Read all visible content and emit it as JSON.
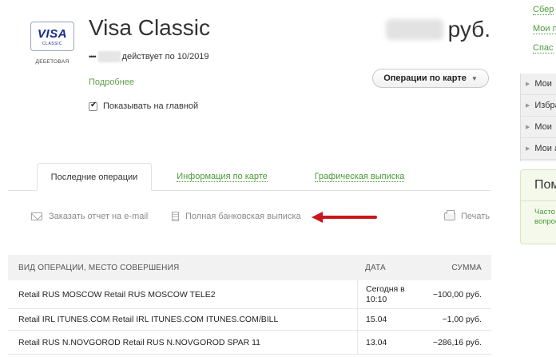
{
  "card": {
    "brand": "VISA",
    "brand_sub": "CLASSIC",
    "kind": "ДЕБЕТОВАЯ",
    "title": "Visa Classic",
    "masked_number": "••••",
    "valid_text": "действует по 10/2019",
    "currency": "руб.",
    "more_link": "Подробнее",
    "show_on_main_label": "Показывать на главной",
    "ops_button": "Операции по карте"
  },
  "tabs": [
    {
      "label": "Последние операции",
      "active": true
    },
    {
      "label": "Информация по карте",
      "active": false
    },
    {
      "label": "Графическая выписка",
      "active": false
    }
  ],
  "actions": {
    "email_report": "Заказать отчет на e-mail",
    "full_statement": "Полная банковская выписка",
    "print": "Печать"
  },
  "table": {
    "headers": [
      "ВИД ОПЕРАЦИИ, МЕСТО СОВЕРШЕНИЯ",
      "ДАТА",
      "СУММА"
    ],
    "rows": [
      {
        "desc": "Retail RUS MOSCOW Retail RUS MOSCOW TELE2",
        "date_line1": "Сегодня в",
        "date_line2": "10:10",
        "amount": "−100,00 руб."
      },
      {
        "desc": "Retail IRL ITUNES.COM Retail IRL ITUNES.COM ITUNES.COM/BILL",
        "date_line1": "15.04",
        "date_line2": "",
        "amount": "−1,00 руб."
      },
      {
        "desc": "Retail RUS N.NOVGOROD Retail RUS N.NOVGOROD SPAR 11",
        "date_line1": "13.04",
        "date_line2": "",
        "amount": "−286,16 руб."
      }
    ]
  },
  "right_column": {
    "links": [
      "Сбер",
      "Мои п",
      "Спас"
    ],
    "menu": [
      "Мои",
      "Избра",
      "Мои",
      "Мои а"
    ],
    "help_title": "Пом",
    "help_text_1": "Часто",
    "help_text_2": "вопрос"
  },
  "colors": {
    "link_green": "#4c9a3a",
    "arrow_red": "#c8171c",
    "visa_blue": "#1a2b8c"
  }
}
